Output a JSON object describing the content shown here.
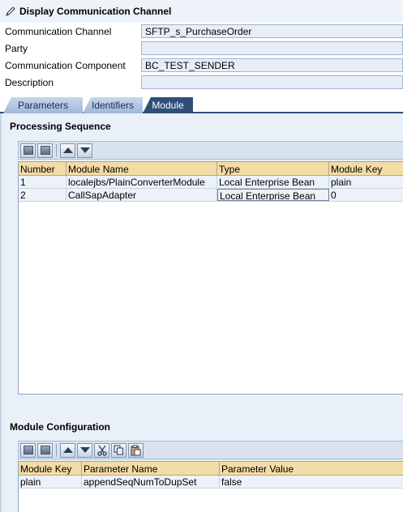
{
  "window": {
    "title": "Display Communication Channel"
  },
  "form": {
    "communication_channel": {
      "label": "Communication Channel",
      "value": "SFTP_s_PurchaseOrder"
    },
    "party": {
      "label": "Party",
      "value": ""
    },
    "communication_component": {
      "label": "Communication Component",
      "value": "BC_TEST_SENDER"
    },
    "description": {
      "label": "Description",
      "value": ""
    }
  },
  "tabs": [
    {
      "label": "Parameters",
      "active": false
    },
    {
      "label": "Identifiers",
      "active": false
    },
    {
      "label": "Module",
      "active": true
    }
  ],
  "processing_sequence": {
    "title": "Processing Sequence",
    "columns": [
      "Number",
      "Module Name",
      "Type",
      "Module Key"
    ],
    "rows": [
      [
        "1",
        "localejbs/PlainConverterModule",
        "Local Enterprise Bean",
        "plain"
      ],
      [
        "2",
        "CallSapAdapter",
        "Local Enterprise Bean",
        "0"
      ]
    ]
  },
  "module_configuration": {
    "title": "Module Configuration",
    "columns": [
      "Module Key",
      "Parameter Name",
      "Parameter Value"
    ],
    "rows": [
      [
        "plain",
        "appendSeqNumToDupSet",
        "false"
      ]
    ]
  },
  "icons": {
    "title": "edit-pencil-icon",
    "toolbar1": [
      "insert-row-icon",
      "delete-row-icon",
      "move-up-icon",
      "move-down-icon"
    ],
    "toolbar2": [
      "insert-row-icon",
      "delete-row-icon",
      "move-up-icon",
      "move-down-icon",
      "cut-icon",
      "copy-icon",
      "paste-icon"
    ]
  },
  "colors": {
    "header": "#f3dca6",
    "active_tab": "#2f4f7a",
    "panel": "#eaf0f8"
  }
}
